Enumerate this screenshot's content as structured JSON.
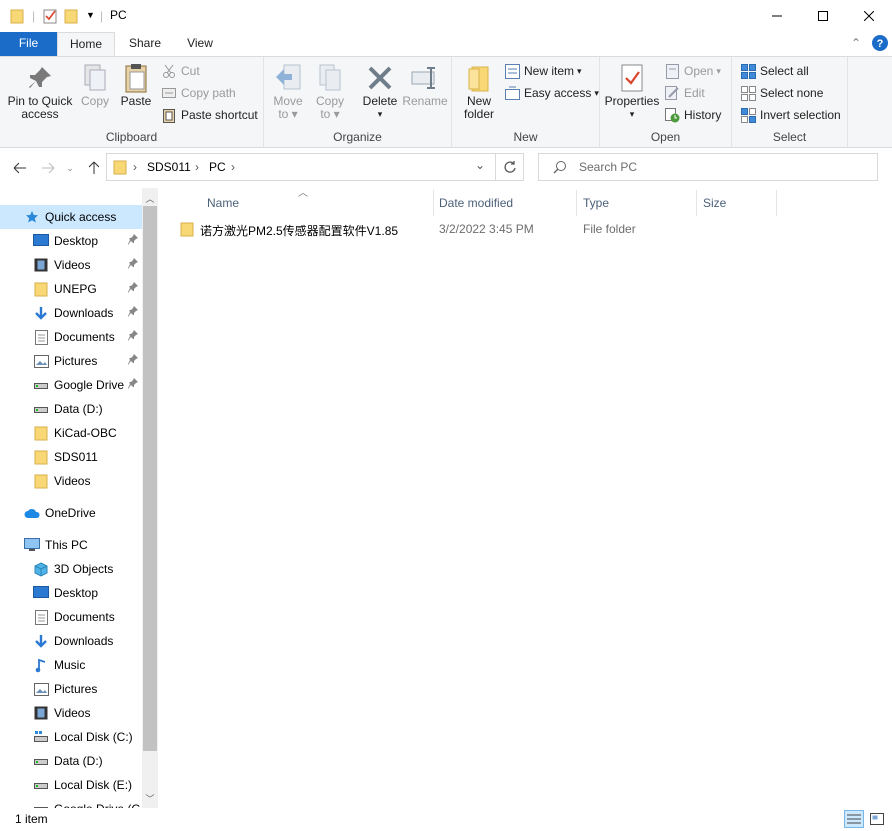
{
  "window": {
    "title": "PC"
  },
  "tabs": {
    "file": "File",
    "home": "Home",
    "share": "Share",
    "view": "View"
  },
  "ribbon": {
    "clipboard": {
      "label": "Clipboard",
      "pin_line1": "Pin to Quick",
      "pin_line2": "access",
      "copy": "Copy",
      "paste": "Paste",
      "cut": "Cut",
      "copy_path": "Copy path",
      "paste_shortcut": "Paste shortcut"
    },
    "organize": {
      "label": "Organize",
      "move_line1": "Move",
      "move_line2": "to",
      "copy_line1": "Copy",
      "copy_line2": "to",
      "delete": "Delete",
      "rename": "Rename"
    },
    "new": {
      "label": "New",
      "new_folder_line1": "New",
      "new_folder_line2": "folder",
      "new_item": "New item",
      "easy_access": "Easy access"
    },
    "open": {
      "label": "Open",
      "properties": "Properties",
      "open": "Open",
      "edit": "Edit",
      "history": "History"
    },
    "select": {
      "label": "Select",
      "select_all": "Select all",
      "select_none": "Select none",
      "invert": "Invert selection"
    }
  },
  "address": {
    "segments": [
      "SDS011",
      "PC"
    ],
    "separator": "›"
  },
  "search": {
    "placeholder": "Search PC"
  },
  "nav": {
    "items": [
      {
        "label": "Quick access",
        "icon": "star-icon",
        "level": 0,
        "selected": true
      },
      {
        "label": "Desktop",
        "icon": "desktop-icon",
        "level": 1,
        "pinned": true
      },
      {
        "label": "Videos",
        "icon": "film-icon",
        "level": 1,
        "pinned": true
      },
      {
        "label": "UNEPG",
        "icon": "folder-icon",
        "level": 1,
        "pinned": true
      },
      {
        "label": "Downloads",
        "icon": "download-icon",
        "level": 1,
        "pinned": true
      },
      {
        "label": "Documents",
        "icon": "document-icon",
        "level": 1,
        "pinned": true
      },
      {
        "label": "Pictures",
        "icon": "pictures-icon",
        "level": 1,
        "pinned": true
      },
      {
        "label": "Google Drive",
        "icon": "drive-icon",
        "level": 1,
        "pinned": true
      },
      {
        "label": "Data (D:)",
        "icon": "drive-icon",
        "level": 1
      },
      {
        "label": "KiCad-OBC",
        "icon": "folder-icon",
        "level": 1
      },
      {
        "label": "SDS011",
        "icon": "folder-icon",
        "level": 1
      },
      {
        "label": "Videos",
        "icon": "folder-icon",
        "level": 1
      },
      {
        "label": "OneDrive",
        "icon": "cloud-icon",
        "level": 0,
        "gap": true
      },
      {
        "label": "This PC",
        "icon": "computer-icon",
        "level": 0,
        "gap": true
      },
      {
        "label": "3D Objects",
        "icon": "cube-icon",
        "level": 1
      },
      {
        "label": "Desktop",
        "icon": "desktop-icon",
        "level": 1
      },
      {
        "label": "Documents",
        "icon": "document-icon",
        "level": 1
      },
      {
        "label": "Downloads",
        "icon": "download-icon",
        "level": 1
      },
      {
        "label": "Music",
        "icon": "music-icon",
        "level": 1
      },
      {
        "label": "Pictures",
        "icon": "pictures-icon",
        "level": 1
      },
      {
        "label": "Videos",
        "icon": "film-icon",
        "level": 1
      },
      {
        "label": "Local Disk (C:)",
        "icon": "windows-drive-icon",
        "level": 1
      },
      {
        "label": "Data (D:)",
        "icon": "drive-icon",
        "level": 1
      },
      {
        "label": "Local Disk (E:)",
        "icon": "drive-icon",
        "level": 1
      },
      {
        "label": "Google Drive (G",
        "icon": "drive-icon",
        "level": 1
      }
    ]
  },
  "columns": {
    "name": "Name",
    "date": "Date modified",
    "type": "Type",
    "size": "Size"
  },
  "files": [
    {
      "name": "诺方激光PM2.5传感器配置软件V1.85",
      "date": "3/2/2022 3:45 PM",
      "type": "File folder",
      "size": ""
    }
  ],
  "status": {
    "count": "1 item"
  },
  "colors": {
    "accent": "#1a6cc8",
    "selection": "#cce8ff",
    "folder": "#f8d775"
  }
}
